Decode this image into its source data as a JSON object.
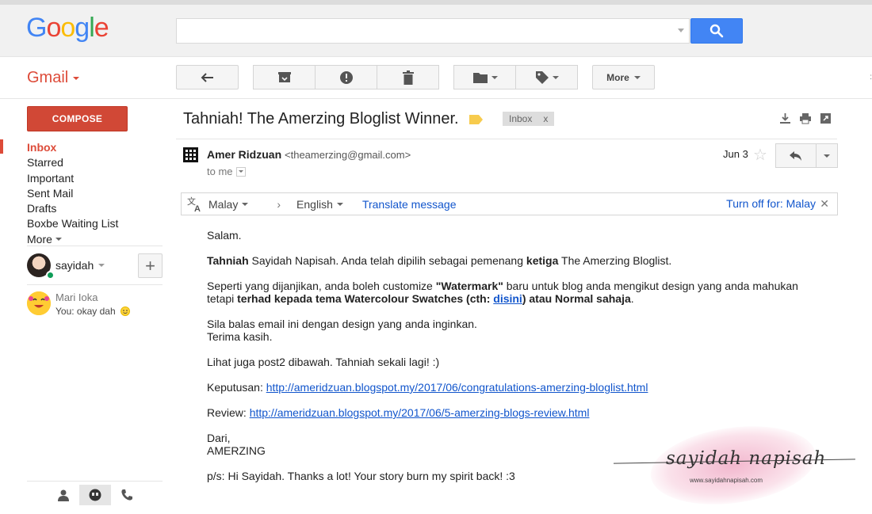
{
  "app": {
    "logo_letters": [
      {
        "ch": "G",
        "color": "#4285f4"
      },
      {
        "ch": "o",
        "color": "#ea4335"
      },
      {
        "ch": "o",
        "color": "#fbbc05"
      },
      {
        "ch": "g",
        "color": "#4285f4"
      },
      {
        "ch": "l",
        "color": "#34a853"
      },
      {
        "ch": "e",
        "color": "#ea4335"
      }
    ],
    "product": "Gmail",
    "accent": "#dd4b39",
    "search_button_color": "#4285f4",
    "link_color": "#1155cc"
  },
  "search": {
    "value": "",
    "placeholder": ""
  },
  "toolbar": {
    "buttons": [
      "back-icon",
      "archive-icon",
      "report-spam-icon",
      "delete-icon",
      "move-to-folder-icon",
      "labels-icon"
    ],
    "more_label": "More"
  },
  "sidebar": {
    "compose_label": "COMPOSE",
    "items": [
      {
        "label": "Inbox",
        "active": true
      },
      {
        "label": "Starred"
      },
      {
        "label": "Important"
      },
      {
        "label": "Sent Mail"
      },
      {
        "label": "Drafts"
      },
      {
        "label": "Boxbe Waiting List"
      },
      {
        "label": "More"
      }
    ],
    "hangouts_user": "sayidah",
    "contact": {
      "name": "Mari Ioka",
      "last_message": "You: okay dah"
    }
  },
  "message": {
    "subject": "Tahniah! The Amerzing Bloglist Winner.",
    "label_chip": "Inbox",
    "label_chip_close": "x",
    "sender_name": "Amer Ridzuan",
    "sender_email": "<theamerzing@gmail.com>",
    "recipient": "to me",
    "date": "Jun 3"
  },
  "translate": {
    "from_lang": "Malay",
    "to_lang": "English",
    "translate_link": "Translate message",
    "turn_off_link": "Turn off for: Malay"
  },
  "body": {
    "greeting": "Salam.",
    "p1_bold1": "Tahniah",
    "p1_text1": " Sayidah Napisah. Anda telah dipilih sebagai pemenang ",
    "p1_bold2": "ketiga",
    "p1_text2": " The Amerzing Bloglist.",
    "p2_text1": "Seperti yang dijanjikan, anda boleh customize ",
    "p2_bold1": "\"Watermark\"",
    "p2_text2": " baru untuk blog anda mengikut design yang anda mahukan",
    "p2_text3": "tetapi ",
    "p2_bold2": "terhad kepada tema Watercolour Swatches (cth: ",
    "p2_link": "disini",
    "p2_bold3": ") atau Normal sahaja",
    "p2_text4": ".",
    "p3_line1": "Sila balas email ini dengan design yang anda inginkan.",
    "p3_line2": "Terima kasih.",
    "p4": "Lihat juga post2 dibawah. Tahniah sekali lagi! :)",
    "p5_label": "Keputusan: ",
    "p5_link": "http://ameridzuan.blogspot.my/2017/06/congratulations-amerzing-bloglist.html",
    "p6_label": "Review: ",
    "p6_link": "http://ameridzuan.blogspot.my/2017/06/5-amerzing-blogs-review.html",
    "p7_line1": "Dari,",
    "p7_line2": "AMERZING",
    "p8": "p/s: Hi Sayidah. Thanks a lot! Your story burn my spirit back! :3"
  },
  "watermark": {
    "signature": "sayidah napisah",
    "url": "www.sayidahnapisah.com"
  }
}
